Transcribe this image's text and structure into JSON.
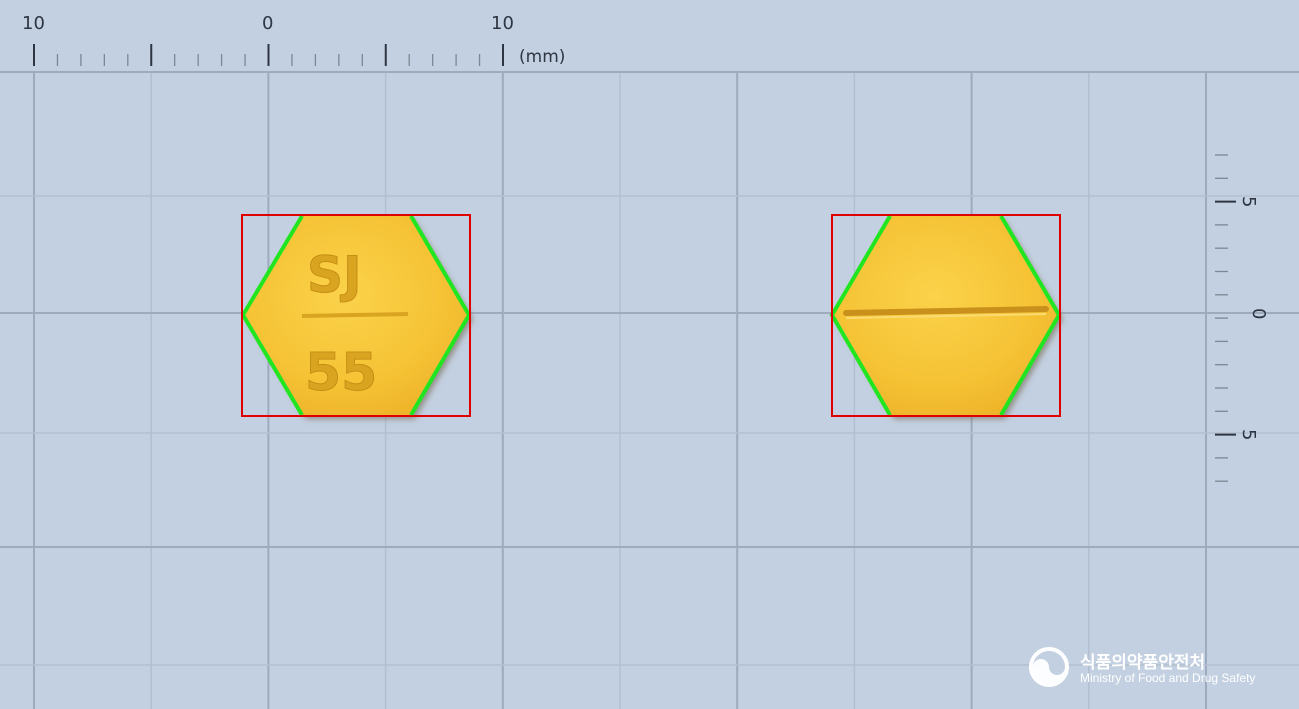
{
  "top_ruler": {
    "labels": [
      "10",
      "0",
      "10"
    ],
    "unit": "(mm)"
  },
  "side_ruler": {
    "labels": [
      "5",
      "0",
      "5"
    ]
  },
  "pills": [
    {
      "face": "front",
      "imprint_top": "SJ",
      "imprint_bottom": "55",
      "color": "#f5c234"
    },
    {
      "face": "back",
      "feature": "score-line",
      "color": "#f5c234"
    }
  ],
  "colors": {
    "background": "#c3d0e1",
    "grid_major": "#9eabbd",
    "grid_minor": "#b2bfd0",
    "bounding_box": "#e00000",
    "contour": "#22e522"
  },
  "logo": {
    "korean": "식품의약품안전처",
    "english": "Ministry of Food and Drug Safety",
    "icon": "mfds-emblem-icon"
  }
}
